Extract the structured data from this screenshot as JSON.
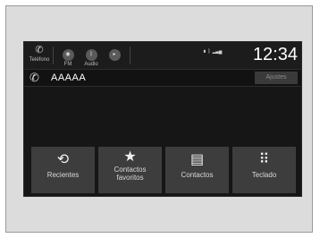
{
  "statusbar": {
    "phone_label": "Teléfono",
    "fm_label": "FM",
    "audio_label": "Audio",
    "clock": "12:34"
  },
  "call": {
    "contact_name": "AAAAA",
    "settings_label": "Ajustes"
  },
  "buttons": [
    {
      "label": "Recientes",
      "icon": "history-icon"
    },
    {
      "label": "Contactos favoritos",
      "icon": "star-icon"
    },
    {
      "label": "Contactos",
      "icon": "contacts-book-icon"
    },
    {
      "label": "Teclado",
      "icon": "keypad-icon"
    }
  ]
}
